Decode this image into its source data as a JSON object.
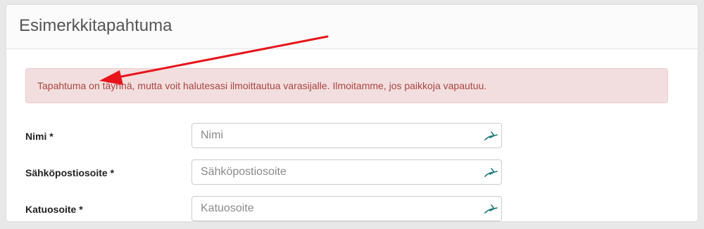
{
  "panel": {
    "title": "Esimerkkitapahtuma"
  },
  "alert": {
    "message": "Tapahtuma on täynnä, mutta voit halutesasi ilmoittautua varasijalle. Ilmoitamme, jos paikkoja vapautuu.",
    "color": "#a94442",
    "background": "#f2dede"
  },
  "form": {
    "fields": [
      {
        "label": "Nimi *",
        "placeholder": "Nimi",
        "icon": "autofill-icon"
      },
      {
        "label": "Sähköpostiosoite *",
        "placeholder": "Sähköpostiosoite",
        "icon": "autofill-icon"
      },
      {
        "label": "Katuosoite *",
        "placeholder": "Katuosoite",
        "icon": "autofill-icon"
      }
    ]
  },
  "annotation": {
    "arrow_color": "#e8141b",
    "icon_color": "#1a7a7a"
  }
}
